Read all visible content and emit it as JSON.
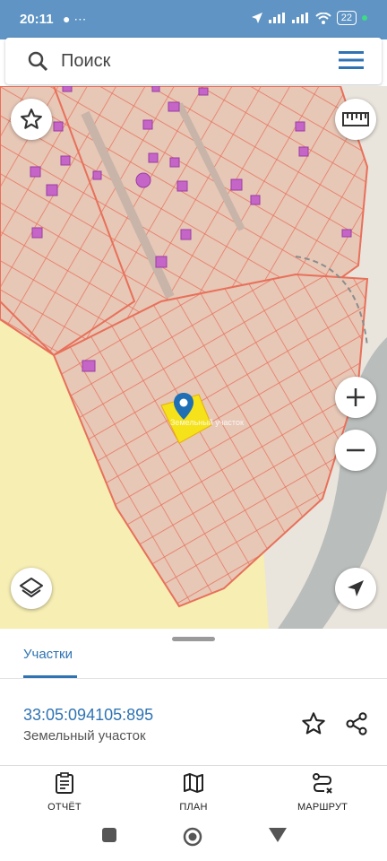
{
  "status_bar": {
    "time": "20:11",
    "notifications": "● ⋯",
    "battery": "22"
  },
  "search": {
    "placeholder": "Поиск"
  },
  "map": {
    "selected_plot_label": "Земельный участок"
  },
  "sheet": {
    "tab_label": "Участки",
    "parcel_id": "33:05:094105:895",
    "parcel_type": "Земельный участок"
  },
  "bottom_nav": {
    "report": "ОТЧЁТ",
    "plan": "ПЛАН",
    "route": "МАРШРУТ"
  },
  "colors": {
    "accent": "#2f73b3",
    "statusbar": "#5f94c4",
    "parcel_line": "#e8705a",
    "parcel_fill": "#e7c7b6",
    "field": "#f6eeb3",
    "selected": "#f5e21b",
    "building": "#c565c8",
    "road": "#b5b9b7"
  }
}
